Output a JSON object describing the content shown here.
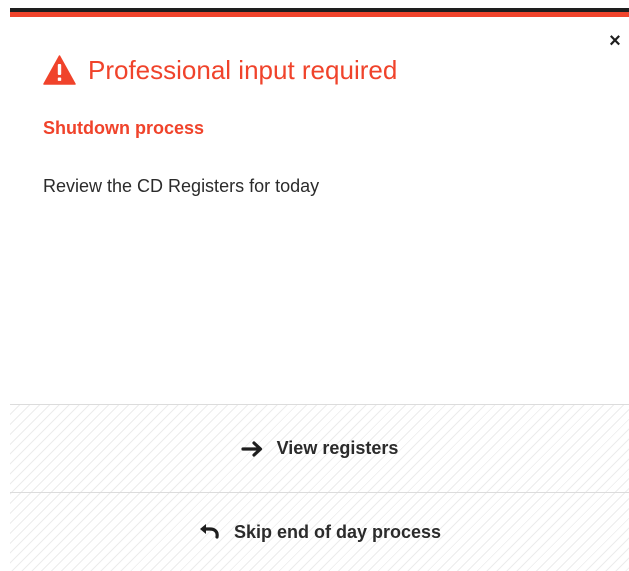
{
  "dialog": {
    "close_label": "×",
    "title": "Professional input required",
    "subtitle": "Shutdown process",
    "message": "Review the CD Registers for today",
    "icon": "warning-icon",
    "accent_color": "#f0432b"
  },
  "actions": {
    "view": {
      "label": "View registers",
      "icon": "arrow-right-icon"
    },
    "skip": {
      "label": "Skip end of day process",
      "icon": "undo-icon"
    }
  }
}
